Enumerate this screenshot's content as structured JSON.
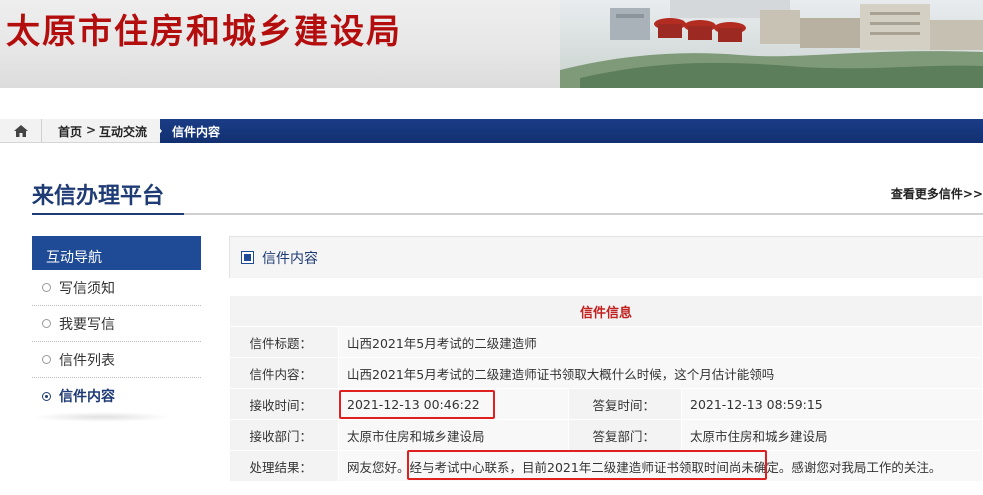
{
  "header": {
    "site_title": "太原市住房和城乡建设局"
  },
  "breadcrumb": {
    "home": "首页",
    "separator": ">",
    "section": "互动交流",
    "current": "信件内容"
  },
  "platform": {
    "title": "来信办理平台",
    "more_link": "查看更多信件>>"
  },
  "sidebar": {
    "heading": "互动导航",
    "items": [
      {
        "label": "写信须知"
      },
      {
        "label": "我要写信"
      },
      {
        "label": "信件列表"
      },
      {
        "label": "信件内容",
        "active": true
      }
    ]
  },
  "panel": {
    "heading": "信件内容"
  },
  "letter": {
    "caption": "信件信息",
    "title_label": "信件标题：",
    "title_value": "山西2021年5月考试的二级建造师",
    "content_label": "信件内容：",
    "content_value": "山西2021年5月考试的二级建造师证书领取大概什么时候，这个月估计能领吗",
    "received_time_label": "接收时间：",
    "received_time_value": "2021-12-13 00:46:22",
    "reply_time_label": "答复时间：",
    "reply_time_value": "2021-12-13 08:59:15",
    "received_dept_label": "接收部门：",
    "received_dept_value": "太原市住房和城乡建设局",
    "reply_dept_label": "答复部门：",
    "reply_dept_value": "太原市住房和城乡建设局",
    "result_label": "处理结果：",
    "result_value": "网友您好。经与考试中心联系，目前2021年二级建造师证书领取时间尚未确定。感谢您对我局工作的关注。"
  },
  "colors": {
    "brand_red": "#b40d0d",
    "nav_blue": "#1f4a96",
    "title_blue": "#1f3b75",
    "highlight_red": "#e02020"
  }
}
